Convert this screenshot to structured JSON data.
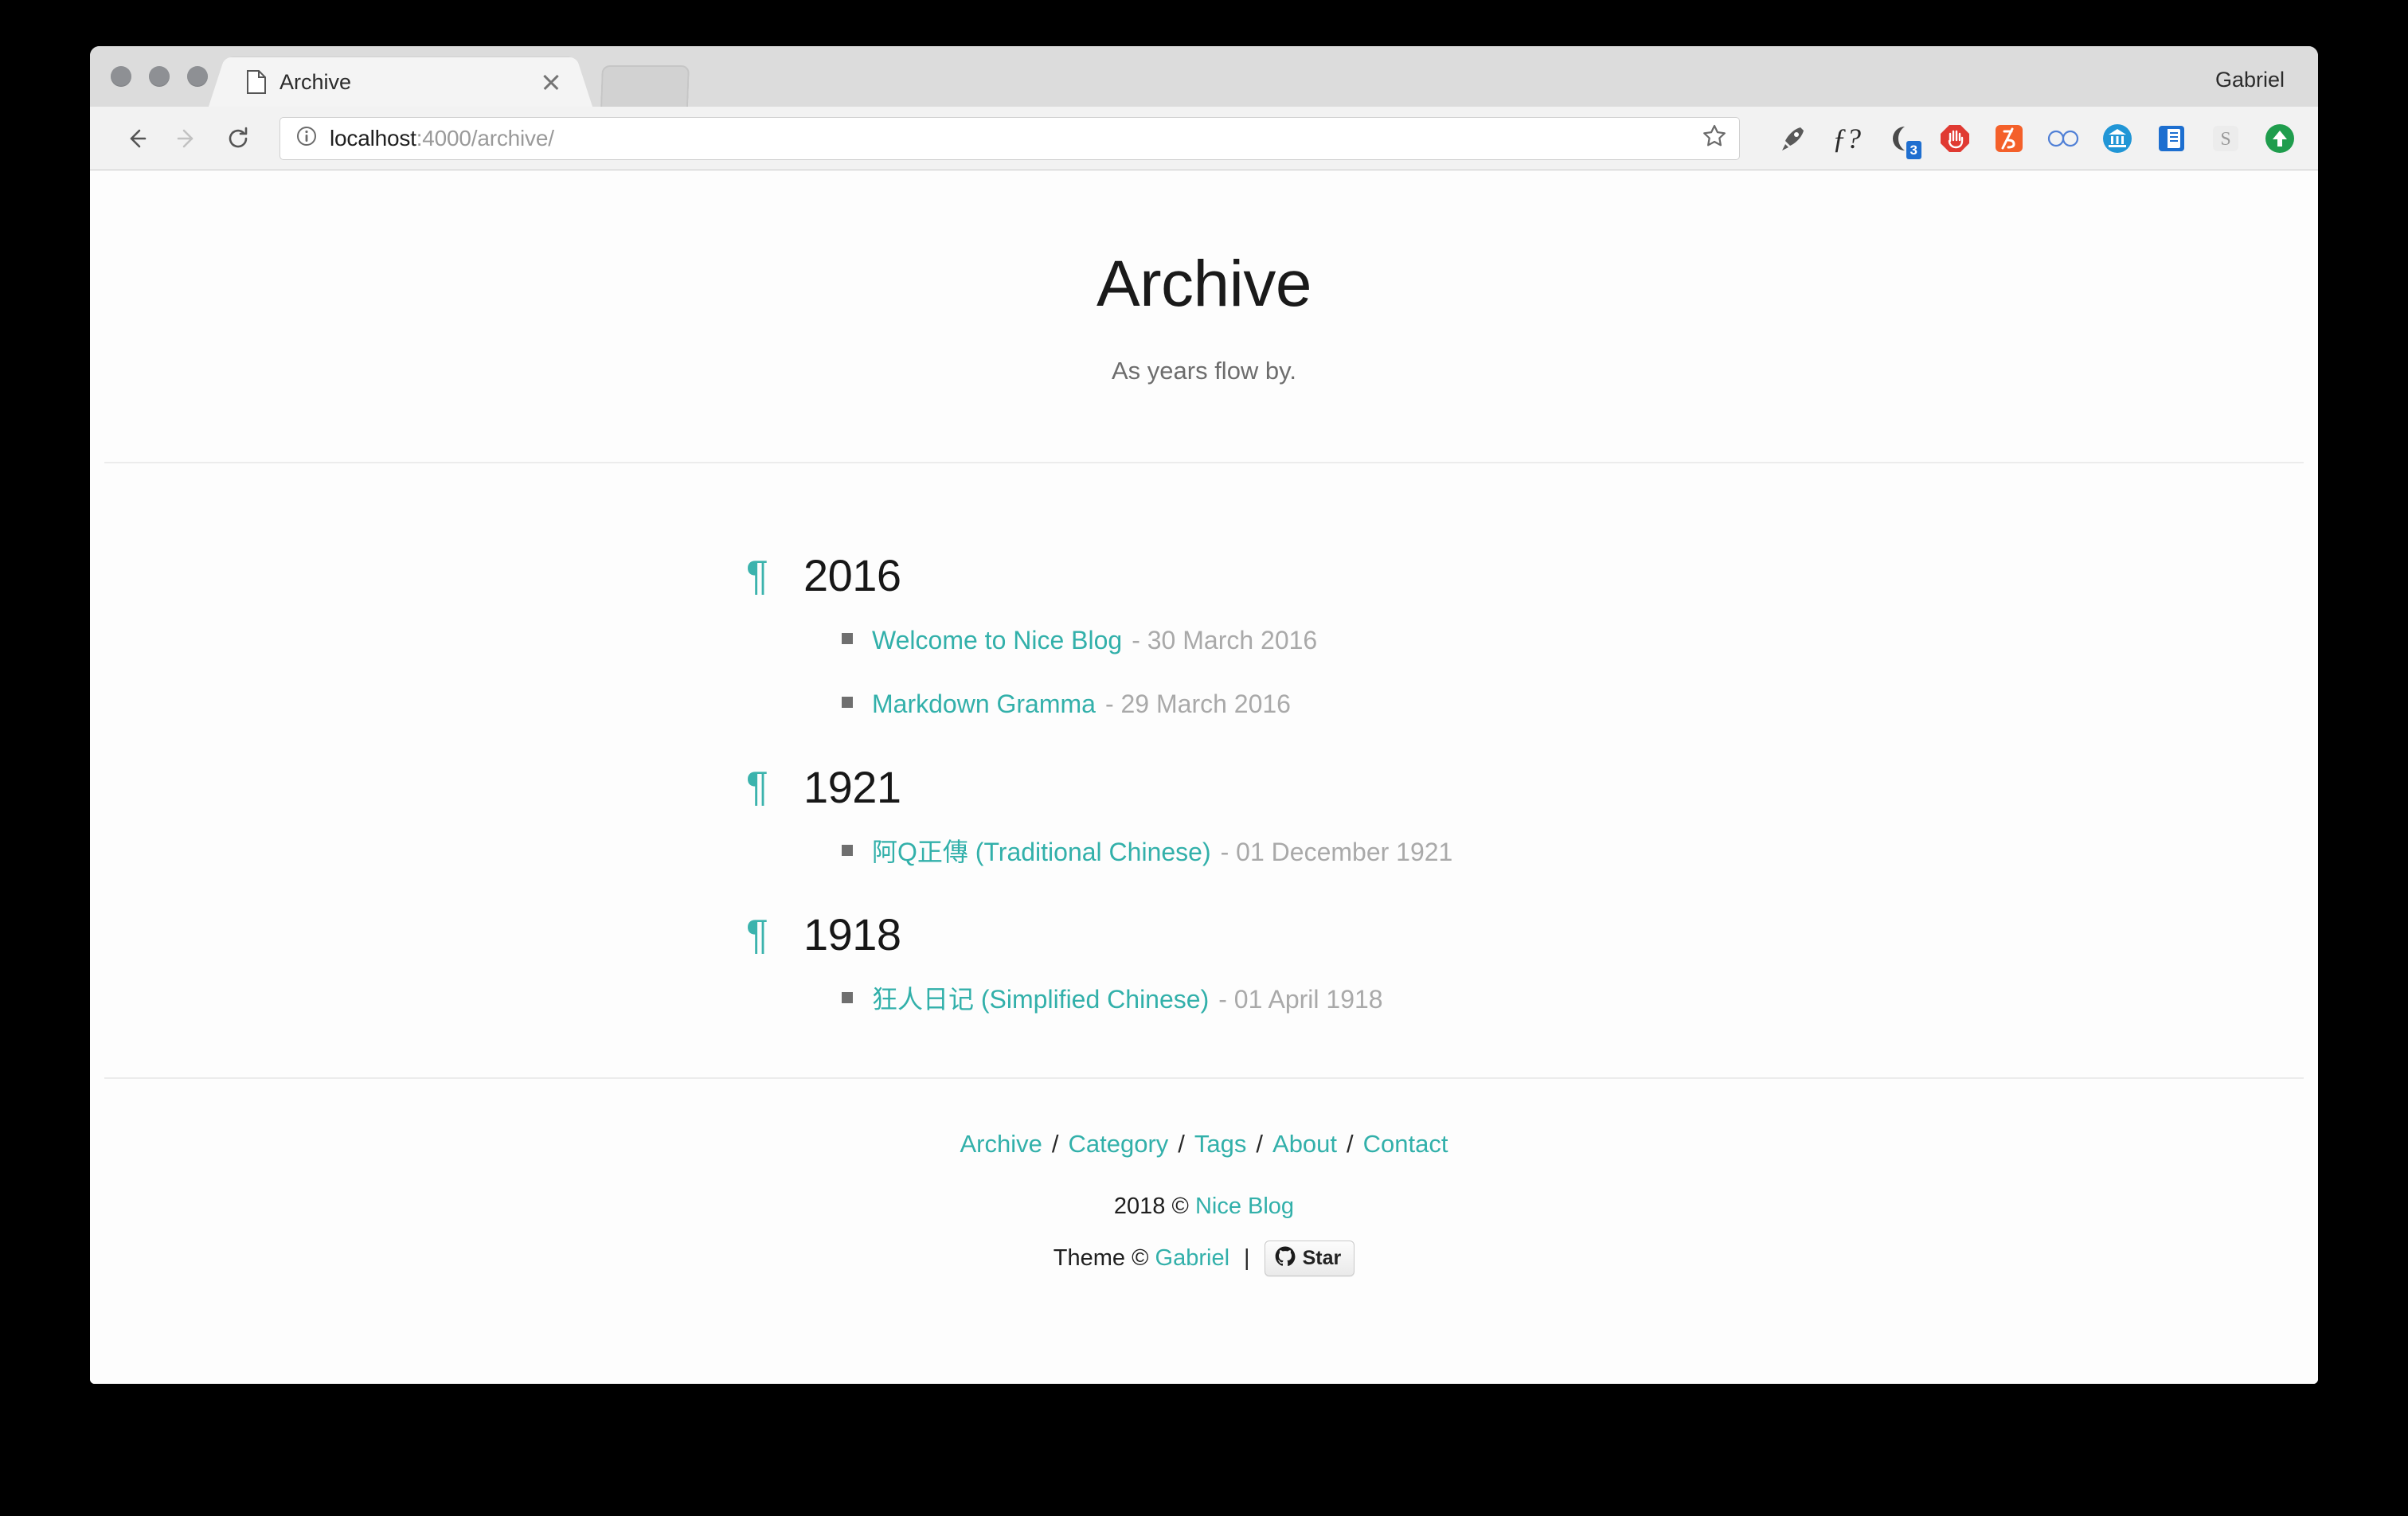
{
  "browser": {
    "profile_name": "Gabriel",
    "tab": {
      "title": "Archive",
      "favicon": "document-icon",
      "close": "close-icon"
    },
    "new_tab_label": "",
    "nav": {
      "back": "back-arrow-icon",
      "forward": "forward-arrow-icon",
      "reload": "reload-icon"
    },
    "omnibox": {
      "security_icon": "info-circle-icon",
      "url_host": "localhost",
      "url_path": ":4000/archive/",
      "url_full": "localhost:4000/archive/",
      "bookmark": "star-outline-icon"
    },
    "extensions": [
      {
        "name": "rocket-icon",
        "glyph": "🚀",
        "badge": ""
      },
      {
        "name": "function-question-icon",
        "glyph": "ƒ?",
        "badge": ""
      },
      {
        "name": "moon-icon",
        "glyph": "◖",
        "badge": "3"
      },
      {
        "name": "adblock-stop-hand-icon",
        "glyph": "✋",
        "badge": ""
      },
      {
        "name": "code-slash-icon",
        "glyph": "╱ʒ",
        "badge": ""
      },
      {
        "name": "glasses-infinity-icon",
        "glyph": "∞",
        "badge": ""
      },
      {
        "name": "bank-museum-icon",
        "glyph": "🏛",
        "badge": ""
      },
      {
        "name": "book-icon",
        "glyph": "📕",
        "badge": ""
      },
      {
        "name": "letter-s-icon",
        "glyph": "S",
        "badge": ""
      },
      {
        "name": "green-up-arrow-icon",
        "glyph": "↑",
        "badge": ""
      }
    ]
  },
  "page": {
    "title": "Archive",
    "subtitle": "As years flow by.",
    "archive": [
      {
        "year": "2016",
        "posts": [
          {
            "title": "Welcome to Nice Blog",
            "date": "- 30 March 2016"
          },
          {
            "title": "Markdown Gramma",
            "date": "- 29 March 2016"
          }
        ]
      },
      {
        "year": "1921",
        "posts": [
          {
            "title": "阿Q正傳 (Traditional Chinese)",
            "date": "- 01 December 1921"
          }
        ]
      },
      {
        "year": "1918",
        "posts": [
          {
            "title": "狂人日记 (Simplified Chinese)",
            "date": "- 01 April 1918"
          }
        ]
      }
    ],
    "footer": {
      "nav": [
        "Archive",
        "Category",
        "Tags",
        "About",
        "Contact"
      ],
      "separator": "/",
      "copyright_year": "2018 ©",
      "copyright_site": "Nice Blog",
      "theme_prefix": "Theme ©",
      "theme_author": "Gabriel",
      "pipe": "|",
      "github_star_label": "Star",
      "github_icon": "github-octocat-icon"
    }
  },
  "colors": {
    "accent_teal": "#32b0aa",
    "pilcrow_teal": "#3bb3ad",
    "muted_gray": "#a9a9a9",
    "text_dark": "#1a1a1a"
  }
}
